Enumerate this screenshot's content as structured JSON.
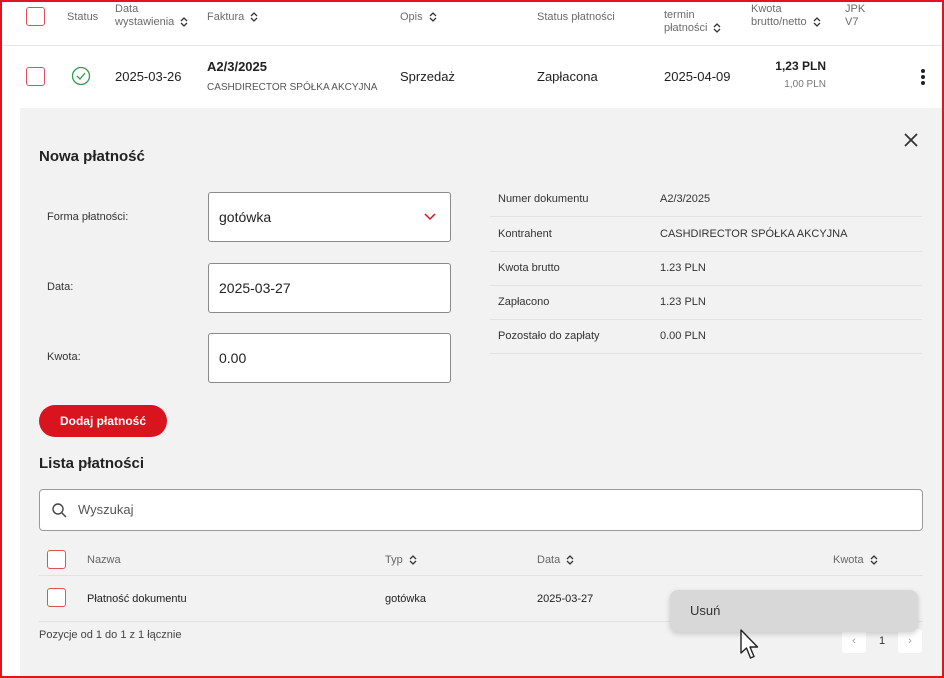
{
  "table_header": {
    "status": "Status",
    "data_wystawienia": "Data wystawienia",
    "faktura": "Faktura",
    "opis": "Opis",
    "status_platnosci": "Status płatności",
    "termin_platnosci": "termin płatności",
    "kwota": "Kwota brutto/netto",
    "jpk": "JPK V7"
  },
  "invoice_row": {
    "date": "2025-03-26",
    "number": "A2/3/2025",
    "company": "CASHDIRECTOR SPÓŁKA AKCYJNA",
    "opis": "Sprzedaż",
    "payment_status": "Zapłacona",
    "due_date": "2025-04-09",
    "gross": "1,23 PLN",
    "net": "1,00 PLN"
  },
  "new_payment": {
    "title": "Nowa płatność",
    "forma_label": "Forma płatności:",
    "forma_value": "gotówka",
    "data_label": "Data:",
    "data_value": "2025-03-27",
    "kwota_label": "Kwota:",
    "kwota_value": "0.00",
    "add_button": "Dodaj płatność"
  },
  "document_info": [
    {
      "label": "Numer dokumentu",
      "value": "A2/3/2025"
    },
    {
      "label": "Kontrahent",
      "value": "CASHDIRECTOR SPÓŁKA AKCYJNA"
    },
    {
      "label": "Kwota brutto",
      "value": "1.23 PLN"
    },
    {
      "label": "Zapłacono",
      "value": "1.23 PLN"
    },
    {
      "label": "Pozostało do zapłaty",
      "value": "0.00 PLN"
    }
  ],
  "payments_list": {
    "title": "Lista płatności",
    "search_placeholder": "Wyszukaj",
    "columns": {
      "nazwa": "Nazwa",
      "typ": "Typ",
      "data": "Data",
      "kwota": "Kwota"
    },
    "rows": [
      {
        "nazwa": "Płatność dokumentu",
        "typ": "gotówka",
        "data": "2025-03-27"
      }
    ],
    "summary": "Pozycje od 1 do 1 z 1 łącznie",
    "page": "1"
  },
  "context_menu": {
    "delete": "Usuń"
  },
  "colors": {
    "accent": "#d9141f",
    "panel_bg": "#f2f2f2",
    "success": "#2e9e4f"
  },
  "icons": [
    "check-circle-icon",
    "sort-icon",
    "kebab-menu-icon",
    "close-icon",
    "chevron-down-icon",
    "search-icon",
    "mouse-pointer-icon"
  ]
}
